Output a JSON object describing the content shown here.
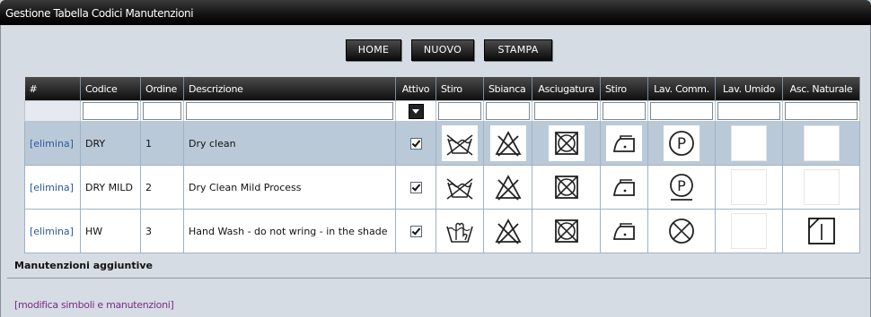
{
  "window": {
    "title": "Gestione Tabella Codici Manutenzioni"
  },
  "toolbar": {
    "home": "HOME",
    "new": "NUOVO",
    "print": "STAMPA"
  },
  "table": {
    "headers": [
      "#",
      "Codice",
      "Ordine",
      "Descrizione",
      "Attivo",
      "Stiro",
      "Sbianca",
      "Asciugatura",
      "Stiro",
      "Lav. Comm.",
      "Lav. Umido",
      "Asc. Naturale"
    ],
    "rows": [
      {
        "action": "[elimina]",
        "code": "DRY",
        "order": "1",
        "description": "Dry clean",
        "active": true,
        "selected": true,
        "symbols": [
          "wash-basin-crossed",
          "bleach-crossed",
          "tumble-dry-crossed",
          "iron-one-dot",
          "dry-clean-p",
          "blank",
          "blank"
        ]
      },
      {
        "action": "[elimina]",
        "code": "DRY MILD",
        "order": "2",
        "description": "Dry Clean Mild Process",
        "active": true,
        "selected": false,
        "symbols": [
          "wash-basin-crossed",
          "bleach-crossed",
          "tumble-dry-crossed",
          "iron-one-dot",
          "dry-clean-p-underline",
          "blank",
          "blank"
        ]
      },
      {
        "action": "[elimina]",
        "code": "HW",
        "order": "3",
        "description": "Hand Wash - do not wring - in the shade",
        "active": true,
        "selected": false,
        "symbols": [
          "hand-wash",
          "bleach-crossed",
          "tumble-dry-crossed",
          "iron-one-dot",
          "no-dry-clean",
          "blank",
          "drip-dry-shade"
        ]
      }
    ]
  },
  "section": {
    "title": "Manutenzioni aggiuntive",
    "link": "[modifica simboli e manutenzioni]"
  }
}
